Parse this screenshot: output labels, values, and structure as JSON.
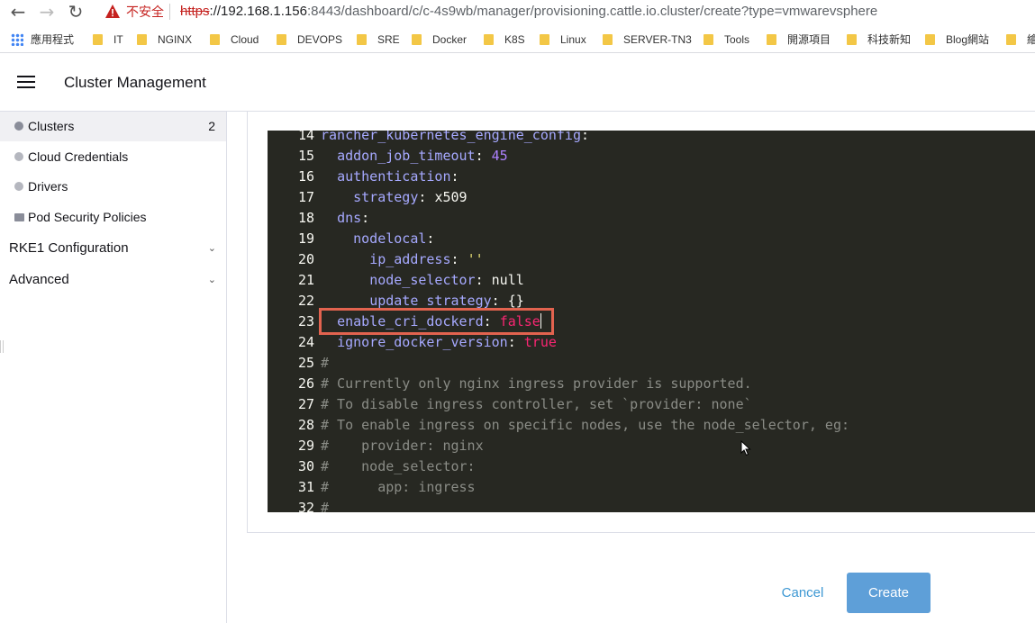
{
  "browser": {
    "back_glyph": "←",
    "forward_glyph": "→",
    "reload_glyph": "↻",
    "security_label": "不安全",
    "url_protocol": "https",
    "url_host": "://192.168.1.156",
    "url_rest": ":8443/dashboard/c/c-4s9wb/manager/provisioning.cattle.io.cluster/create?type=vmwarevsphere"
  },
  "bookmarks": [
    {
      "label": "應用程式",
      "icon": "apps-grid-icon"
    },
    {
      "label": "IT",
      "icon": "folder-icon"
    },
    {
      "label": "NGINX",
      "icon": "folder-icon"
    },
    {
      "label": "Cloud",
      "icon": "folder-icon"
    },
    {
      "label": "DEVOPS",
      "icon": "folder-icon"
    },
    {
      "label": "SRE",
      "icon": "folder-icon"
    },
    {
      "label": "Docker",
      "icon": "folder-icon"
    },
    {
      "label": "K8S",
      "icon": "folder-icon"
    },
    {
      "label": "Linux",
      "icon": "folder-icon"
    },
    {
      "label": "SERVER-TN3",
      "icon": "folder-icon"
    },
    {
      "label": "Tools",
      "icon": "folder-icon"
    },
    {
      "label": "開源項目",
      "icon": "folder-icon"
    },
    {
      "label": "科技新知",
      "icon": "folder-icon"
    },
    {
      "label": "Blog網站",
      "icon": "folder-icon"
    },
    {
      "label": "繪",
      "icon": "folder-icon"
    }
  ],
  "header": {
    "title": "Cluster Management"
  },
  "sidebar": {
    "items": [
      {
        "label": "Clusters",
        "count": "2",
        "icon": "globe-icon"
      },
      {
        "label": "Cloud Credentials",
        "icon": "globe-icon"
      },
      {
        "label": "Drivers",
        "icon": "globe-icon"
      },
      {
        "label": "Pod Security Policies",
        "icon": "folder-icon"
      }
    ],
    "groups": [
      {
        "label": "RKE1 Configuration",
        "icon": "chevron-down-icon"
      },
      {
        "label": "Advanced",
        "icon": "chevron-down-icon"
      }
    ]
  },
  "editor": {
    "lines": [
      {
        "num": "14",
        "key": "rancher_kubernetes_engine_config",
        "indent": ""
      },
      {
        "num": "15",
        "key": "addon_job_timeout",
        "value": "45",
        "indent": "  "
      },
      {
        "num": "16",
        "key": "authentication",
        "indent": "  "
      },
      {
        "num": "17",
        "key": "strategy",
        "value": "x509",
        "indent": "    "
      },
      {
        "num": "18",
        "key": "dns",
        "indent": "  "
      },
      {
        "num": "19",
        "key": "nodelocal",
        "indent": "    "
      },
      {
        "num": "20",
        "key": "ip_address",
        "value": "''",
        "indent": "      "
      },
      {
        "num": "21",
        "key": "node_selector",
        "value": "null",
        "indent": "      "
      },
      {
        "num": "22",
        "key": "update_strategy",
        "value": "{}",
        "indent": "      "
      },
      {
        "num": "23",
        "key": "enable_cri_dockerd",
        "value": "false",
        "indent": "  "
      },
      {
        "num": "24",
        "key": "ignore_docker_version",
        "value": "true",
        "indent": "  "
      },
      {
        "num": "25",
        "comment": "#"
      },
      {
        "num": "26",
        "comment": "# Currently only nginx ingress provider is supported."
      },
      {
        "num": "27",
        "comment": "# To disable ingress controller, set `provider: none`"
      },
      {
        "num": "28",
        "comment": "# To enable ingress on specific nodes, use the node_selector, eg:"
      },
      {
        "num": "29",
        "comment": "#    provider: nginx"
      },
      {
        "num": "30",
        "comment": "#    node_selector:"
      },
      {
        "num": "31",
        "comment": "#      app: ingress"
      },
      {
        "num": "32",
        "comment": "#"
      }
    ]
  },
  "actions": {
    "cancel_label": "Cancel",
    "create_label": "Create"
  },
  "colors": {
    "editor_bg": "#272822",
    "highlight_border": "#e2634f",
    "create_button": "#5e9fd8",
    "cancel_text": "#3d98d3"
  }
}
